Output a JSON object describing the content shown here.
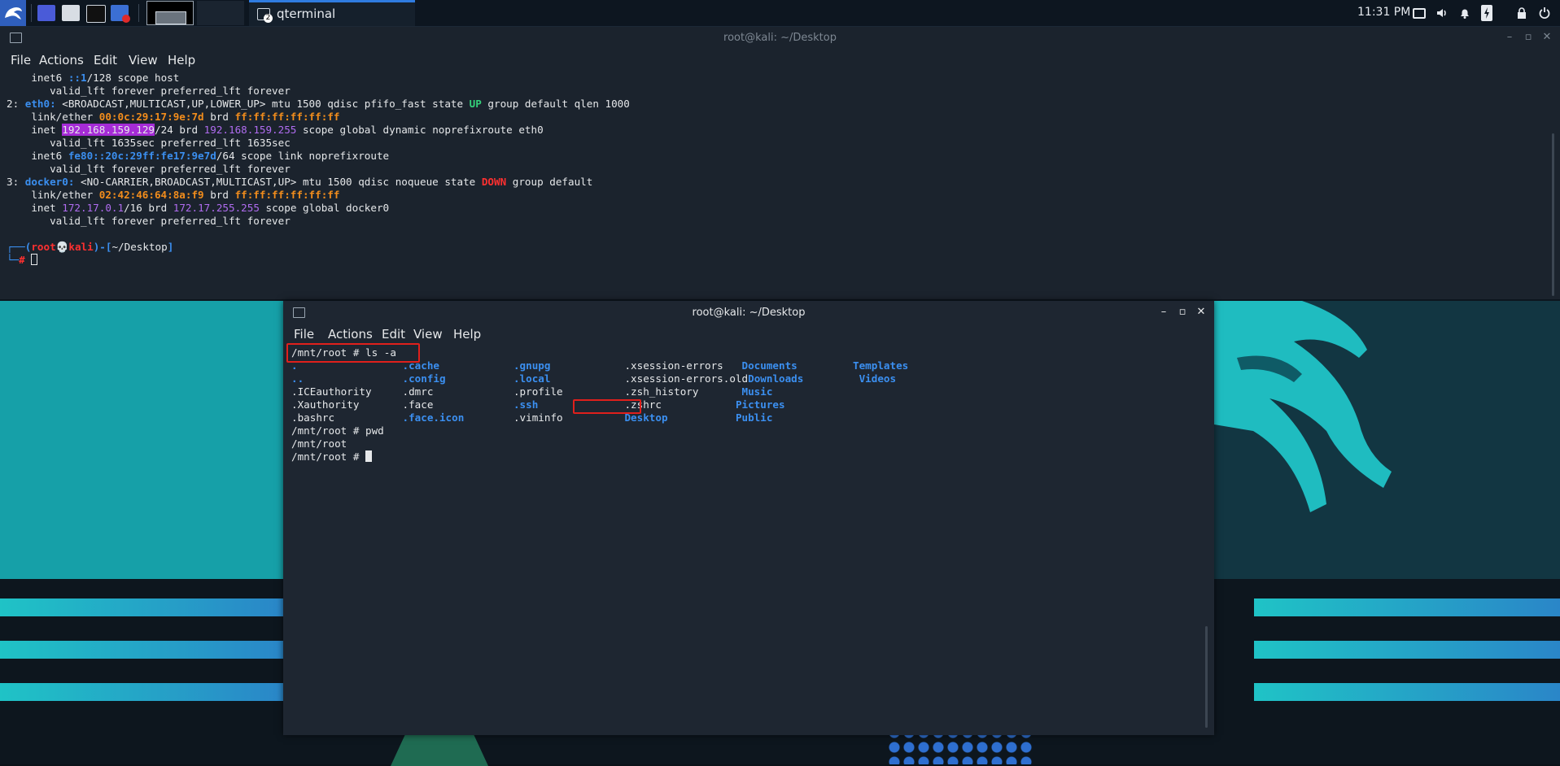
{
  "taskbar": {
    "task_label": "qterminal",
    "task_badge": "2",
    "clock": "11:31 PM"
  },
  "colors": {
    "accent": "#2f7ce0",
    "terminal_bg": "#1b232d",
    "highlight_box": "#e0201c",
    "dir_blue": "#3b8ff0",
    "selection_purple": "#a52bd6"
  },
  "top_window": {
    "title": "root@kali: ~/Desktop",
    "menu": [
      "File",
      "Actions",
      "Edit",
      "View",
      "Help"
    ],
    "lines": [
      [
        {
          "t": "    inet6 ",
          "c": "c-w"
        },
        {
          "t": "::1",
          "c": "c-b"
        },
        {
          "t": "/128 scope host",
          "c": "c-w"
        }
      ],
      [
        {
          "t": "       valid_lft forever preferred_lft forever",
          "c": "c-w"
        }
      ],
      [
        {
          "t": "2: ",
          "c": "c-w"
        },
        {
          "t": "eth0:",
          "c": "c-b"
        },
        {
          "t": " <BROADCAST,MULTICAST,UP,LOWER_UP> mtu 1500 qdisc pfifo_fast state ",
          "c": "c-w"
        },
        {
          "t": "UP",
          "c": "c-g"
        },
        {
          "t": " group default qlen 1000",
          "c": "c-w"
        }
      ],
      [
        {
          "t": "    link/ether ",
          "c": "c-w"
        },
        {
          "t": "00:0c:29:17:9e:7d",
          "c": "c-o"
        },
        {
          "t": " brd ",
          "c": "c-w"
        },
        {
          "t": "ff:ff:ff:ff:ff:ff",
          "c": "c-o"
        }
      ],
      [
        {
          "t": "    inet ",
          "c": "c-w"
        },
        {
          "t": "192.168.159.129",
          "c": "sel"
        },
        {
          "t": "/24 brd ",
          "c": "c-w"
        },
        {
          "t": "192.168.159.255",
          "c": "c-p"
        },
        {
          "t": " scope global dynamic noprefixroute eth0",
          "c": "c-w"
        }
      ],
      [
        {
          "t": "       valid_lft 1635sec preferred_lft 1635sec",
          "c": "c-w"
        }
      ],
      [
        {
          "t": "    inet6 ",
          "c": "c-w"
        },
        {
          "t": "fe80::20c:29ff:fe17:9e7d",
          "c": "c-b"
        },
        {
          "t": "/64 scope link noprefixroute",
          "c": "c-w"
        }
      ],
      [
        {
          "t": "       valid_lft forever preferred_lft forever",
          "c": "c-w"
        }
      ],
      [
        {
          "t": "3: ",
          "c": "c-w"
        },
        {
          "t": "docker0:",
          "c": "c-b"
        },
        {
          "t": " <NO-CARRIER,BROADCAST,MULTICAST,UP> mtu 1500 qdisc noqueue state ",
          "c": "c-w"
        },
        {
          "t": "DOWN",
          "c": "c-r"
        },
        {
          "t": " group default",
          "c": "c-w"
        }
      ],
      [
        {
          "t": "    link/ether ",
          "c": "c-w"
        },
        {
          "t": "02:42:46:64:8a:f9",
          "c": "c-o"
        },
        {
          "t": " brd ",
          "c": "c-w"
        },
        {
          "t": "ff:ff:ff:ff:ff:ff",
          "c": "c-o"
        }
      ],
      [
        {
          "t": "    inet ",
          "c": "c-w"
        },
        {
          "t": "172.17.0.1",
          "c": "c-p"
        },
        {
          "t": "/16 brd ",
          "c": "c-w"
        },
        {
          "t": "172.17.255.255",
          "c": "c-p"
        },
        {
          "t": " scope global docker0",
          "c": "c-w"
        }
      ],
      [
        {
          "t": "       valid_lft forever preferred_lft forever",
          "c": "c-w"
        }
      ],
      [
        {
          "t": " ",
          "c": "c-w"
        }
      ],
      [
        {
          "t": "┌──(",
          "c": "c-b"
        },
        {
          "t": "root",
          "c": "c-r"
        },
        {
          "t": "💀",
          "c": "c-w"
        },
        {
          "t": "kali",
          "c": "c-r"
        },
        {
          "t": ")-[",
          "c": "c-b"
        },
        {
          "t": "~/Desktop",
          "c": "c-w"
        },
        {
          "t": "]",
          "c": "c-b"
        }
      ],
      [
        {
          "t": "└─",
          "c": "c-b"
        },
        {
          "t": "# ",
          "c": "c-r"
        },
        {
          "t": "",
          "c": "cursor-box"
        }
      ]
    ]
  },
  "bottom_window": {
    "title": "root@kali: ~/Desktop",
    "menu": [
      "File",
      "Actions",
      "Edit",
      "View",
      "Help"
    ],
    "lines": [
      [
        {
          "t": "/mnt/root # ls -a",
          "c": "c-w"
        }
      ],
      [
        {
          "t": ".                 ",
          "c": "c-b"
        },
        {
          "t": ".cache            ",
          "c": "c-b"
        },
        {
          "t": ".gnupg            ",
          "c": "c-b"
        },
        {
          "t": ".xsession-errors   ",
          "c": "c-w"
        },
        {
          "t": "Documents         ",
          "c": "c-b"
        },
        {
          "t": "Templates",
          "c": "c-b"
        }
      ],
      [
        {
          "t": "..                ",
          "c": "c-b"
        },
        {
          "t": ".config           ",
          "c": "c-b"
        },
        {
          "t": ".local            ",
          "c": "c-b"
        },
        {
          "t": ".xsession-errors.old",
          "c": "c-w"
        },
        {
          "t": "Downloads         ",
          "c": "c-b"
        },
        {
          "t": "Videos",
          "c": "c-b"
        }
      ],
      [
        {
          "t": ".ICEauthority     ",
          "c": "c-w"
        },
        {
          "t": ".dmrc             ",
          "c": "c-w"
        },
        {
          "t": ".profile          ",
          "c": "c-w"
        },
        {
          "t": ".zsh_history       ",
          "c": "c-w"
        },
        {
          "t": "Music",
          "c": "c-b"
        }
      ],
      [
        {
          "t": ".Xauthority       ",
          "c": "c-w"
        },
        {
          "t": ".face             ",
          "c": "c-w"
        },
        {
          "t": ".ssh              ",
          "c": "c-b"
        },
        {
          "t": ".zshrc            ",
          "c": "c-w"
        },
        {
          "t": "Pictures",
          "c": "c-b"
        }
      ],
      [
        {
          "t": ".bashrc           ",
          "c": "c-w"
        },
        {
          "t": ".face.icon        ",
          "c": "c-b"
        },
        {
          "t": ".viminfo          ",
          "c": "c-w"
        },
        {
          "t": "Desktop           ",
          "c": "c-b"
        },
        {
          "t": "Public",
          "c": "c-b"
        }
      ],
      [
        {
          "t": "/mnt/root # pwd",
          "c": "c-w"
        }
      ],
      [
        {
          "t": "/mnt/root",
          "c": "c-w"
        }
      ],
      [
        {
          "t": "/mnt/root # ",
          "c": "c-w"
        },
        {
          "t": "",
          "c": "cursor-fill"
        }
      ]
    ]
  }
}
